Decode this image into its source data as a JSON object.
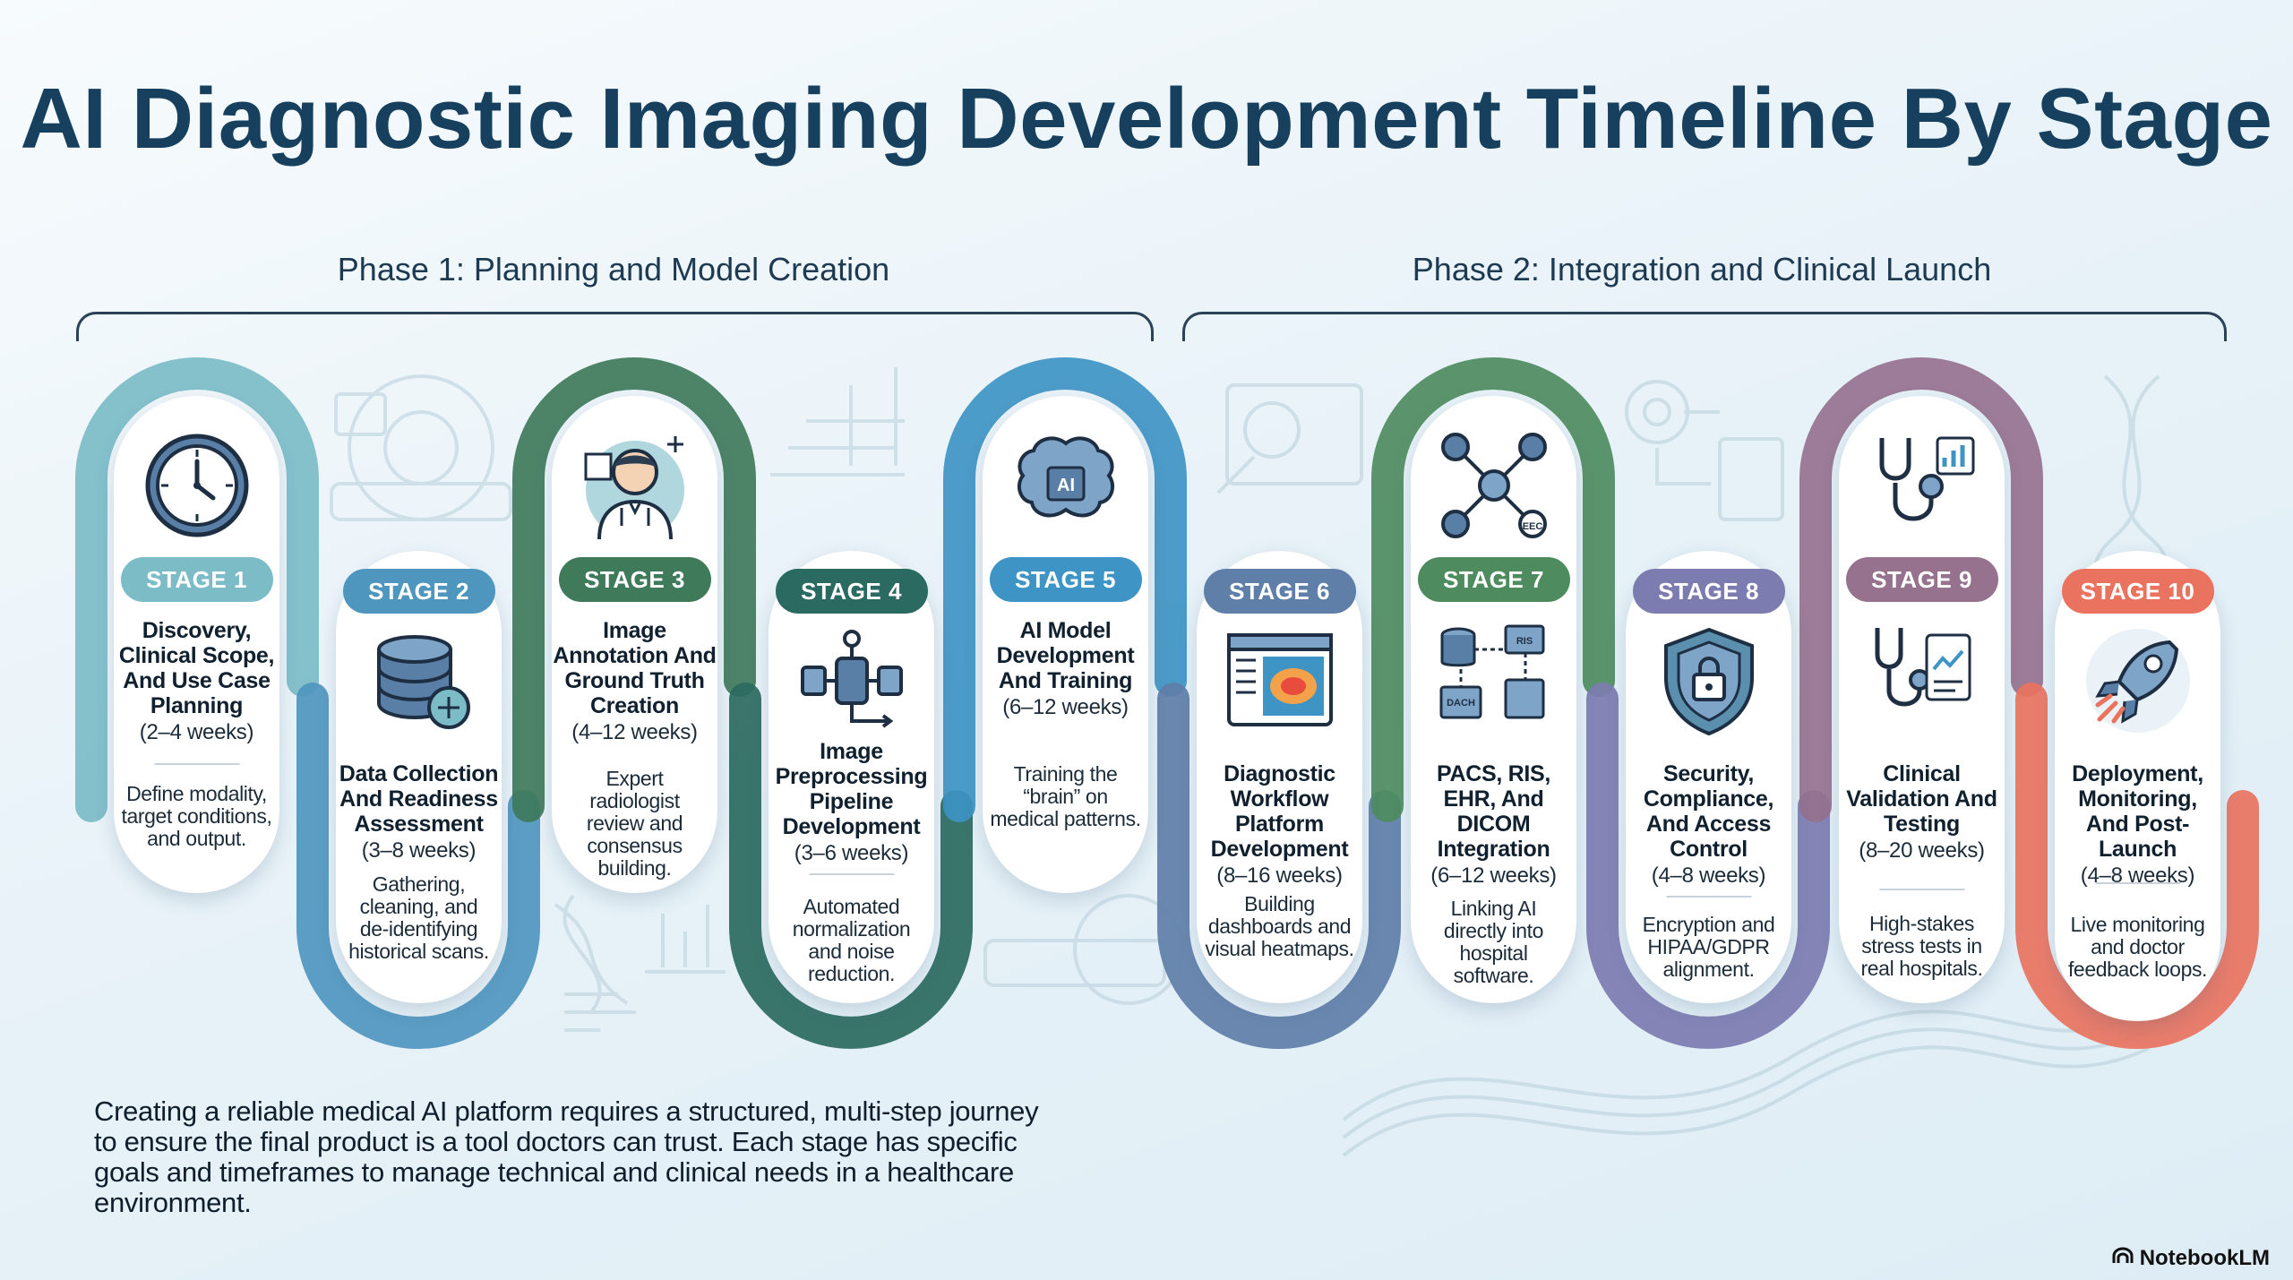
{
  "title": "AI Diagnostic Imaging Development Timeline By Stage",
  "phases": [
    {
      "label": "Phase 1: Planning and Model Creation"
    },
    {
      "label": "Phase 2: Integration and Clinical Launch"
    }
  ],
  "stages": [
    {
      "badge": "STAGE 1",
      "title": "Discovery, Clinical Scope, And Use Case Planning",
      "duration": "(2–4 weeks)",
      "description": "Define modality, target conditions, and output.",
      "color": "#7bbcc7",
      "icon": "clock-icon"
    },
    {
      "badge": "STAGE 2",
      "title": "Data Collection And Readiness Assessment",
      "duration": "(3–8 weeks)",
      "description": "Gathering, cleaning, and de-identifying historical scans.",
      "color": "#4f96bf",
      "icon": "database-icon"
    },
    {
      "badge": "STAGE 3",
      "title": "Image Annotation And Ground Truth Creation",
      "duration": "(4–12 weeks)",
      "description": "Expert radiologist review and consensus building.",
      "color": "#3f7a5b",
      "icon": "doctor-icon"
    },
    {
      "badge": "STAGE 4",
      "title": "Image Preprocessing Pipeline Development",
      "duration": "(3–6 weeks)",
      "description": "Automated normalization and noise reduction.",
      "color": "#2b6a60",
      "icon": "pipeline-icon"
    },
    {
      "badge": "STAGE 5",
      "title": "AI Model Development And Training",
      "duration": "(6–12 weeks)",
      "description": "Training the “brain” on medical patterns.",
      "color": "#3e94c4",
      "icon": "ai-brain-icon"
    },
    {
      "badge": "STAGE 6",
      "title": "Diagnostic Workflow Platform Development",
      "duration": "(8–16 weeks)",
      "description": "Building dashboards and visual heatmaps.",
      "color": "#5f7fa8",
      "icon": "heatmap-dashboard-icon"
    },
    {
      "badge": "STAGE 7",
      "title": "PACS, RIS, EHR, And DICOM Integration",
      "duration": "(6–12 weeks)",
      "description": "Linking AI directly into hospital software.",
      "color": "#4e8c60",
      "icon": "integration-icon"
    },
    {
      "badge": "STAGE 8",
      "title": "Security, Compliance, And Access Control",
      "duration": "(4–8 weeks)",
      "description": "Encryption and HIPAA/GDPR alignment.",
      "color": "#7c7cb0",
      "icon": "shield-lock-icon"
    },
    {
      "badge": "STAGE 9",
      "title": "Clinical Validation And Testing",
      "duration": "(8–20 weeks)",
      "description": "High-stakes stress tests in real hospitals.",
      "color": "#96728f",
      "icon": "stethoscope-chart-icon"
    },
    {
      "badge": "STAGE 10",
      "title": "Deployment, Monitoring, And Post-Launch",
      "duration": "(4–8 weeks)",
      "description": "Live monitoring and doctor feedback loops.",
      "color": "#e9735f",
      "icon": "rocket-icon"
    }
  ],
  "footer": "Creating a reliable medical AI platform requires a structured, multi-step journey to ensure the final product is a tool doctors can trust. Each stage has specific goals and timeframes to manage technical and clinical needs in a healthcare environment.",
  "brand": "NotebookLM"
}
